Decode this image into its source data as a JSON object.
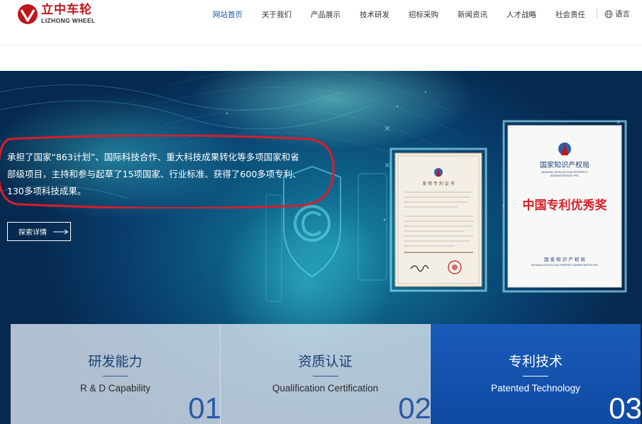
{
  "brand": {
    "name_cn": "立中车轮",
    "name_en": "LIZHONG WHEEL",
    "color": "#c0161c"
  },
  "nav": {
    "items": [
      {
        "label": "网站首页",
        "active": true
      },
      {
        "label": "关于我们",
        "active": false
      },
      {
        "label": "产品展示",
        "active": false
      },
      {
        "label": "技术研发",
        "active": false
      },
      {
        "label": "招标采购",
        "active": false
      },
      {
        "label": "新闻资讯",
        "active": false
      },
      {
        "label": "人才战略",
        "active": false
      },
      {
        "label": "社会责任",
        "active": false
      }
    ],
    "language_label": "语言",
    "language_icon": "globe-icon",
    "active_color": "#1a55a8"
  },
  "hero": {
    "text_lines": [
      "承担了国家“863计划”、国际科技合作、重大科技成果转化等多项国家和省",
      "部级项目，主持和参与起草了15项国家、行业标准、获得了600多项专利、",
      "130多项科技成果。"
    ],
    "explore_label": "探索详情",
    "highlight_color": "#d81e2a",
    "certificate_left": {
      "title": "发 明 专 利 证 书"
    },
    "certificate_right": {
      "org_cn": "国家知识产权局",
      "org_en_1": "NATIONAL INTELLECTUAL PROPERTY",
      "org_en_2": "ADMINISTRATION, PRC",
      "award": "中国专利优秀奖",
      "footer_cn": "国 家 知 识 产 权 局",
      "footer_en": "NATIONAL INTELLECTUAL PROPERTY ADMINISTRATION, PRC"
    }
  },
  "cards": [
    {
      "title": "研发能力",
      "subtitle": "R & D Capability",
      "number": "01",
      "style": "light"
    },
    {
      "title": "资质认证",
      "subtitle": "Qualification Certification",
      "number": "02",
      "style": "light"
    },
    {
      "title": "专利技术",
      "subtitle": "Patented Technology",
      "number": "03",
      "style": "blue"
    }
  ]
}
